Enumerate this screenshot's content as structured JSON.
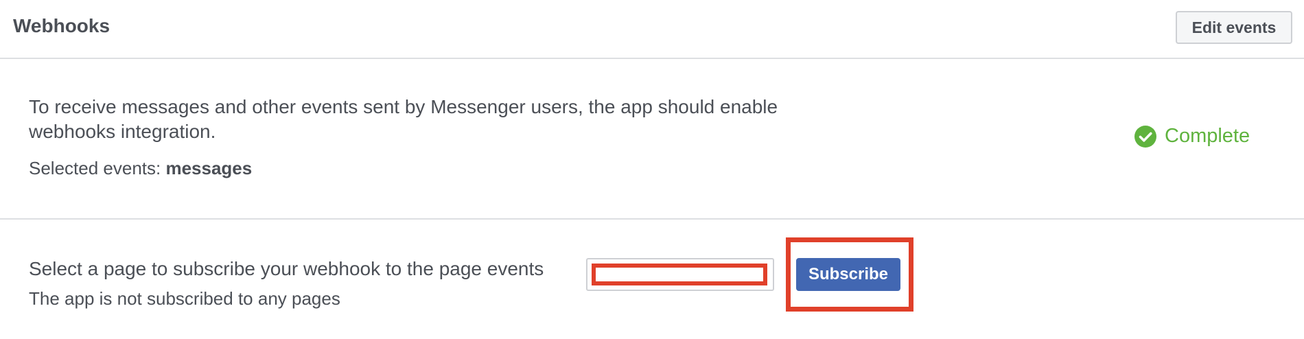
{
  "header": {
    "title": "Webhooks",
    "edit_button_label": "Edit events"
  },
  "integration": {
    "description": "To receive messages and other events sent by Messenger users, the app should enable webhooks integration.",
    "selected_events_label": "Selected events:",
    "selected_events_value": "messages",
    "status_text": "Complete",
    "status_icon": "check-circle-icon"
  },
  "subscription": {
    "prompt": "Select a page to subscribe your webhook to the page events",
    "status_text": "The app is not subscribed to any pages",
    "page_select_value": "",
    "subscribe_button_label": "Subscribe"
  },
  "colors": {
    "status_green": "#5fb33e",
    "primary_button": "#4267b2",
    "highlight_red": "#e0402a",
    "text": "#4b4f56",
    "divider": "#dddfe2"
  }
}
